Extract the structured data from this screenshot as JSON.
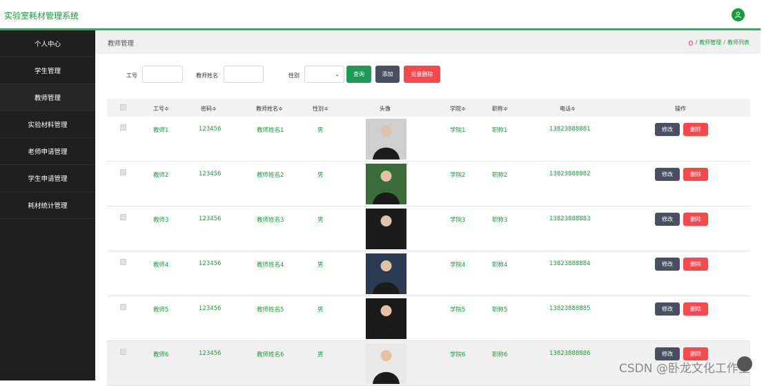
{
  "app": {
    "title": "实验室耗材管理系统"
  },
  "sidebar": {
    "items": [
      {
        "label": "个人中心"
      },
      {
        "label": "学生管理"
      },
      {
        "label": "教师管理"
      },
      {
        "label": "实验材料管理"
      },
      {
        "label": "老师申请管理"
      },
      {
        "label": "学生申请管理"
      },
      {
        "label": "耗材统计管理"
      }
    ]
  },
  "page": {
    "title": "教师管理",
    "breadcrumb": {
      "sep1": "/",
      "level1": "教师管理",
      "sep2": "/",
      "level2": "教师列表"
    }
  },
  "search": {
    "id_label": "工号",
    "id_value": "",
    "name_label": "教师姓名",
    "name_value": "",
    "gender_label": "性别",
    "gender_selected": "",
    "query_btn": "查询",
    "add_btn": "添加",
    "batch_delete_btn": "批量删除"
  },
  "table": {
    "columns": {
      "id": "工号≑",
      "password": "密码≑",
      "name": "教师姓名≑",
      "gender": "性别≑",
      "avatar": "头像",
      "college": "学院≑",
      "title": "职称≑",
      "phone": "电话≑",
      "ops": "操作"
    },
    "rows": [
      {
        "id": "教师1",
        "password": "123456",
        "name": "教师姓名1",
        "gender": "男",
        "college": "学院1",
        "title": "职称1",
        "phone": "13823888881"
      },
      {
        "id": "教师2",
        "password": "123456",
        "name": "教师姓名2",
        "gender": "男",
        "college": "学院2",
        "title": "职称2",
        "phone": "13823888882"
      },
      {
        "id": "教师3",
        "password": "123456",
        "name": "教师姓名3",
        "gender": "男",
        "college": "学院3",
        "title": "职称3",
        "phone": "13823888883"
      },
      {
        "id": "教师4",
        "password": "123456",
        "name": "教师姓名4",
        "gender": "男",
        "college": "学院4",
        "title": "职称4",
        "phone": "13823888884"
      },
      {
        "id": "教师5",
        "password": "123456",
        "name": "教师姓名5",
        "gender": "男",
        "college": "学院5",
        "title": "职称5",
        "phone": "13823888885"
      },
      {
        "id": "教师6",
        "password": "123456",
        "name": "教师姓名6",
        "gender": "男",
        "college": "学院6",
        "title": "职称6",
        "phone": "13823888886"
      }
    ],
    "edit_label": "修改",
    "delete_label": "删除"
  },
  "watermark": "CSDN @卧龙文化工作室",
  "colors": {
    "accent": "#1a9c3c",
    "sidebar_bg": "#1f1f1f",
    "danger": "#f5484c",
    "dark_btn": "#4a4f62"
  }
}
